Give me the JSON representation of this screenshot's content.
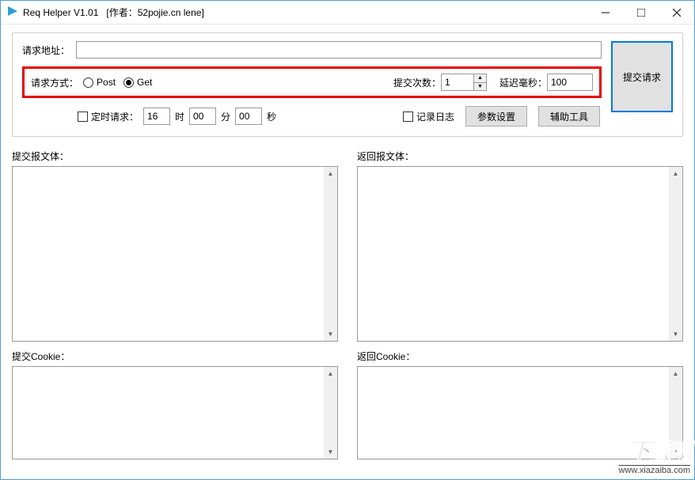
{
  "window": {
    "title": "Req Helper V1.01",
    "author": "[作者：52pojie.cn lene]"
  },
  "form": {
    "url_label": "请求地址：",
    "url_value": "",
    "method_label": "请求方式：",
    "method_post": "Post",
    "method_get": "Get",
    "count_label": "提交次数：",
    "count_value": "1",
    "delay_label": "延迟毫秒：",
    "delay_value": "100",
    "submit_label": "提交请求",
    "timed_checkbox": "定时请求：",
    "time_hour": "16",
    "time_hour_unit": "时",
    "time_min": "00",
    "time_min_unit": "分",
    "time_sec": "00",
    "time_sec_unit": "秒",
    "log_checkbox": "记录日志",
    "params_button": "参数设置",
    "tools_button": "辅助工具"
  },
  "panels": {
    "request_body_label": "提交报文体：",
    "response_body_label": "返回报文体：",
    "request_cookie_label": "提交Cookie：",
    "response_cookie_label": "返回Cookie："
  },
  "watermark": {
    "top": "下载吧",
    "bottom": "www.xiazaiba.com"
  }
}
